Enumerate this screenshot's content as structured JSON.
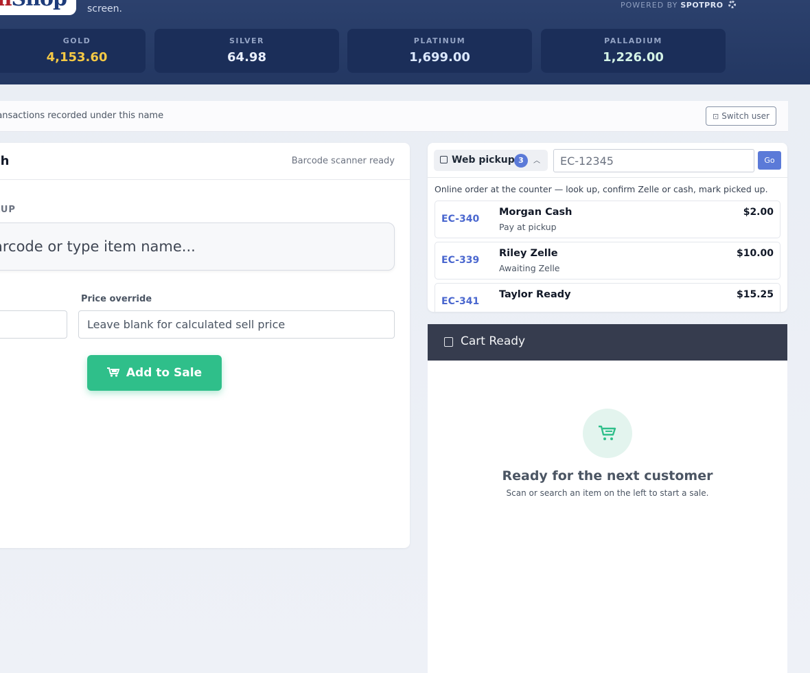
{
  "header": {
    "logo_text_red": "n",
    "logo_text_blue": "Shop",
    "subtitle": "screen.",
    "powered_by_label": "POWERED BY",
    "powered_by_brand": "SPOTPRO",
    "settings_icon": "gear-icon"
  },
  "metals": [
    {
      "label": "GOLD",
      "value": "4,153.60"
    },
    {
      "label": "SILVER",
      "value": "64.98"
    },
    {
      "label": "PLATINUM",
      "value": "1,699.00"
    },
    {
      "label": "PALLADIUM",
      "value": "1,226.00"
    }
  ],
  "userbar": {
    "text": "ransactions recorded under this name",
    "switch_label": "Switch user"
  },
  "left_panel": {
    "title": "ch",
    "status": "Barcode scanner ready",
    "pickup_label": "KUP",
    "search_placeholder": "arcode or type item name...",
    "price_override_label": "Price override",
    "price_override_placeholder": "Leave blank for calculated sell price",
    "add_button": "Add to Sale"
  },
  "web_pickup": {
    "toggle_label": "Web pickup",
    "count": "3",
    "order_placeholder": "EC-12345",
    "go_label": "Go",
    "description": "Online order at the counter — look up, confirm Zelle or cash, mark picked up.",
    "orders": [
      {
        "id": "EC-340",
        "name": "Morgan Cash",
        "status": "Pay at pickup",
        "amount": "$2.00"
      },
      {
        "id": "EC-339",
        "name": "Riley Zelle",
        "status": "Awaiting Zelle",
        "amount": "$10.00"
      },
      {
        "id": "EC-341",
        "name": "Taylor Ready",
        "status": "",
        "amount": "$15.25"
      }
    ]
  },
  "cart": {
    "title": "Cart Ready",
    "empty_title": "Ready for the next customer",
    "empty_subtitle": "Scan or search an item on the left to start a sale.",
    "accent": "#2fbf8a"
  }
}
